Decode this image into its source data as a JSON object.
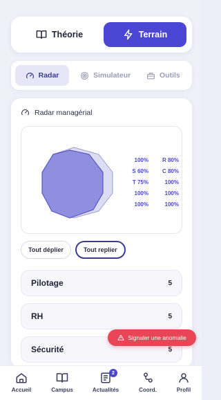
{
  "mode": {
    "theorie_label": "Théorie",
    "terrain_label": "Terrain",
    "active": "terrain"
  },
  "tabs": [
    {
      "label": "Radar",
      "icon": "gauge-icon",
      "active": true
    },
    {
      "label": "Simulateur",
      "icon": "target-icon",
      "active": false
    },
    {
      "label": "Outils",
      "icon": "toolbox-icon",
      "active": false
    }
  ],
  "radar": {
    "title": "Radar managérial",
    "legend": [
      [
        "100%",
        "R 80%"
      ],
      [
        "S 60%",
        "C 80%"
      ],
      [
        "T 75%",
        "100%"
      ],
      [
        "100%",
        "100%"
      ],
      [
        "100%",
        "100%"
      ]
    ]
  },
  "actions": {
    "expand_all": "Tout déplier",
    "collapse_all": "Tout replier"
  },
  "sections": [
    {
      "label": "Pilotage",
      "count": "5"
    },
    {
      "label": "RH",
      "count": "5"
    },
    {
      "label": "Sécurité",
      "count": "5"
    }
  ],
  "report_label": "Signaler une anomalie",
  "nav": [
    {
      "label": "Accueil",
      "icon": "home-icon"
    },
    {
      "label": "Campus",
      "icon": "book-icon"
    },
    {
      "label": "Actualités",
      "icon": "news-icon",
      "badge": "2"
    },
    {
      "label": "Coord.",
      "icon": "network-icon"
    },
    {
      "label": "Profil",
      "icon": "user-icon"
    }
  ],
  "colors": {
    "accent": "#4b46d4",
    "danger": "#e84656",
    "radar_fill": "#8f8fe0",
    "radar_bg": "#d9d9f1"
  }
}
